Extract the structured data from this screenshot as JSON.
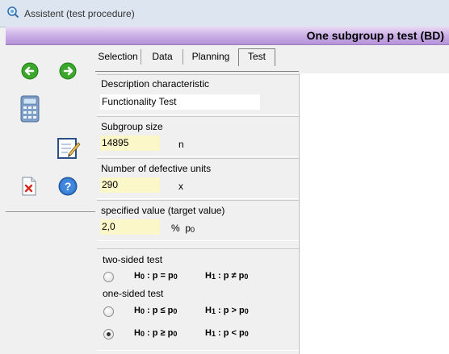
{
  "window": {
    "title": "Assistent (test procedure)"
  },
  "header": {
    "title": "One subgroup p test (BD)"
  },
  "tabs": [
    {
      "label": "Selection",
      "active": false
    },
    {
      "label": "Data",
      "active": false
    },
    {
      "label": "Planning",
      "active": false
    },
    {
      "label": "Test",
      "active": true
    }
  ],
  "toolbar": {
    "icons": [
      "back-arrow-icon",
      "forward-arrow-icon",
      "calculator-icon",
      "edit-form-icon",
      "delete-document-icon",
      "help-icon"
    ]
  },
  "fields": {
    "description": {
      "label": "Description characteristic",
      "value": "Functionality Test"
    },
    "subgroup_size": {
      "label": "Subgroup size",
      "value": "14895",
      "unit": "n"
    },
    "defective_units": {
      "label": "Number of defective units",
      "value": "290",
      "unit": "x"
    },
    "specified_value": {
      "label": "specified value (target value)",
      "value": "2,0",
      "unit_prefix": "%",
      "unit_symbol": "p",
      "unit_sub": "0"
    }
  },
  "test_options": {
    "two_sided_label": "two-sided test",
    "one_sided_label": "one-sided test",
    "options": [
      {
        "h0": "H",
        "h0_sub": "0",
        "h0_rest": ": p = p",
        "h0_sub2": "0",
        "h1": "H",
        "h1_sub": "1",
        "h1_rest": ": p ≠ p",
        "h1_sub2": "0",
        "checked": false
      },
      {
        "h0": "H",
        "h0_sub": "0",
        "h0_rest": ": p ≤ p",
        "h0_sub2": "0",
        "h1": "H",
        "h1_sub": "1",
        "h1_rest": ": p > p",
        "h1_sub2": "0",
        "checked": false
      },
      {
        "h0": "H",
        "h0_sub": "0",
        "h0_rest": ": p ≥ p",
        "h0_sub2": "0",
        "h1": "H",
        "h1_sub": "1",
        "h1_rest": ": p < p",
        "h1_sub2": "0",
        "checked": true
      }
    ]
  },
  "colors": {
    "header_accent": "#b592d8",
    "input_highlight": "#fbf7c8"
  }
}
